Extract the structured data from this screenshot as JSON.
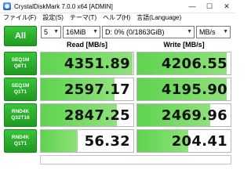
{
  "window": {
    "title": "CrystalDiskMark 7.0.0 x64 [ADMIN]",
    "minimize": "—",
    "maximize": "☐",
    "close": "✕"
  },
  "menu": [
    "ファイル(F)",
    "設定(S)",
    "テーマ(T)",
    "ヘルプ(H)",
    "言語(Language)"
  ],
  "controls": {
    "all_label": "All",
    "count": "5",
    "size": "16MiB",
    "drive": "D: 0% (0/1863GiB)",
    "unit": "MB/s"
  },
  "headers": {
    "read": "Read [MB/s]",
    "write": "Write [MB/s]"
  },
  "rows": [
    {
      "line1": "SEQ1M",
      "line2": "Q8T1",
      "read": "4351.89",
      "write": "4206.55",
      "read_level": 0.99,
      "write_level": 0.96
    },
    {
      "line1": "SEQ1M",
      "line2": "Q1T1",
      "read": "2597.17",
      "write": "4195.90",
      "read_level": 0.8,
      "write_level": 0.96
    },
    {
      "line1": "RND4K",
      "line2": "Q32T16",
      "read": "2847.25",
      "write": "2469.96",
      "read_level": 0.82,
      "write_level": 0.78
    },
    {
      "line1": "RND4K",
      "line2": "Q1T1",
      "read": "56.32",
      "write": "204.41",
      "read_level": 0.4,
      "write_level": 0.55
    }
  ],
  "colors": {
    "accent_green": "#2fb232",
    "fill_green": "#6fd85c"
  }
}
